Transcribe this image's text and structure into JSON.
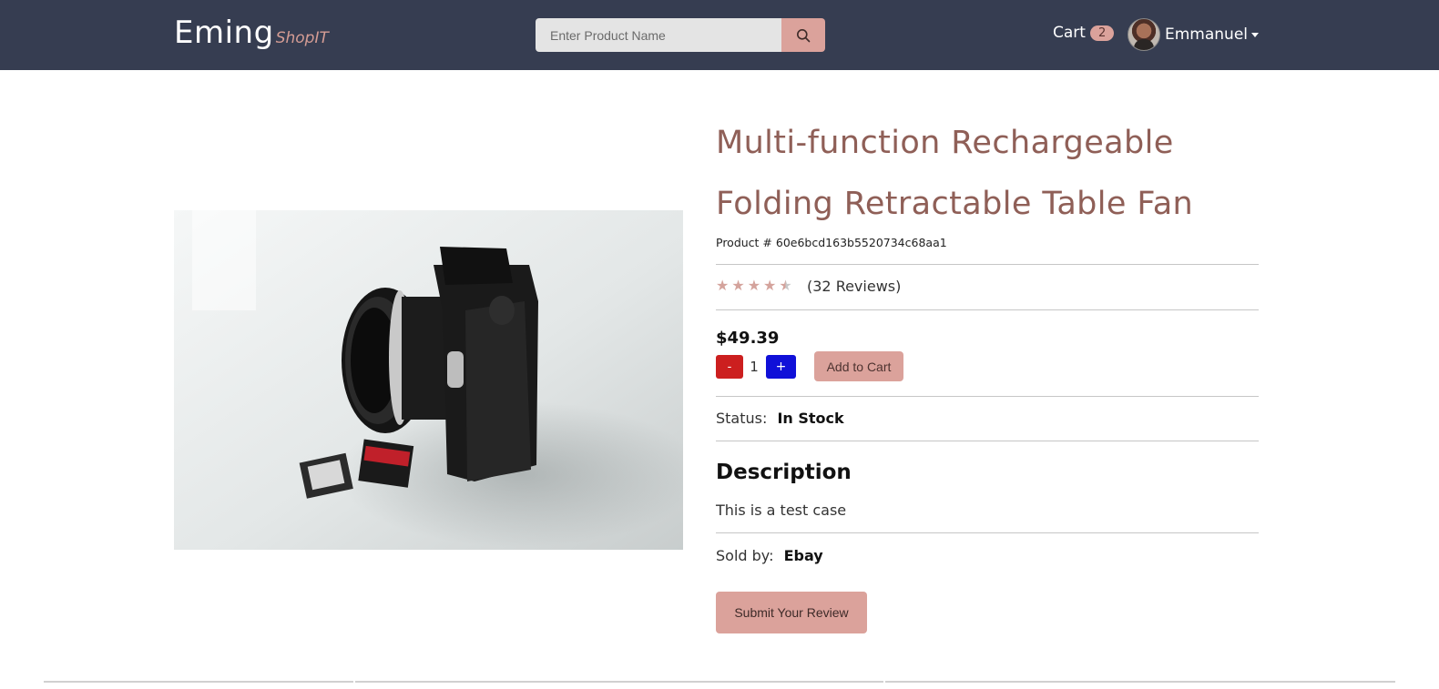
{
  "header": {
    "brand_main": "Eming",
    "brand_sub": "ShopIT",
    "search_placeholder": "Enter Product Name",
    "cart_label": "Cart",
    "cart_count": "2",
    "user_name": "Emmanuel"
  },
  "product": {
    "title": "Multi-function Rechargeable Folding Retractable Table Fan",
    "product_id_label": "Product # 60e6bcd163b5520734c68aa1",
    "rating": 4.5,
    "rating_max": 5,
    "reviews_label": "(32 Reviews)",
    "price": "$49.39",
    "minus_label": "-",
    "quantity": "1",
    "plus_label": "+",
    "add_to_cart_label": "Add to Cart",
    "status_label": "Status:",
    "status_value": "In Stock",
    "description_heading": "Description",
    "description_text": "This is a test case",
    "sold_by_label": "Sold by:",
    "sold_by_value": "Ebay",
    "submit_review_label": "Submit Your Review"
  },
  "colors": {
    "navbar": "#363d51",
    "accent": "#dba29b",
    "title": "#8f5f57",
    "minus_button": "#cc1f1f",
    "plus_button": "#1010d8"
  },
  "icons": {
    "search": "search-icon",
    "caret": "caret-down-icon",
    "star": "star-icon"
  }
}
